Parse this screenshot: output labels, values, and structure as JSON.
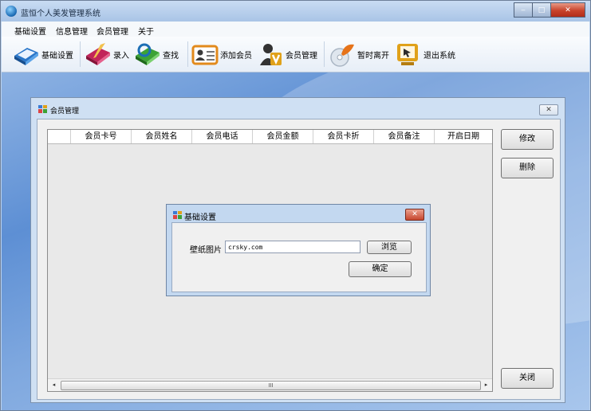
{
  "app": {
    "title": "蓝恒个人美发管理系统"
  },
  "window_controls": {
    "minimize": "‒",
    "maximize": "□",
    "close": "✕"
  },
  "menu": [
    "基础设置",
    "信息管理",
    "会员管理",
    "关于"
  ],
  "toolbar": [
    {
      "label": "基础设置",
      "icon": "settings-book-icon",
      "color": "#2a76c9"
    },
    {
      "label": "录入",
      "icon": "edit-book-icon",
      "color": "#c2245a"
    },
    {
      "label": "查找",
      "icon": "search-recycle-icon",
      "color": "#3ca235"
    },
    {
      "label": "添加会员",
      "icon": "add-member-card-icon",
      "color": "#e28a1c"
    },
    {
      "label": "会员管理",
      "icon": "member-manage-icon",
      "color": "#e0a11a"
    },
    {
      "label": "暂时离开",
      "icon": "away-disc-icon",
      "color": "#e6731a"
    },
    {
      "label": "退出系统",
      "icon": "exit-system-icon",
      "color": "#e0a11a"
    }
  ],
  "member_window": {
    "title": "会员管理",
    "close": "✕",
    "columns": [
      "会员卡号",
      "会员姓名",
      "会员电话",
      "会员金额",
      "会员卡折",
      "会员备注",
      "开启日期"
    ],
    "buttons": {
      "edit": "修改",
      "delete": "删除",
      "close": "关闭"
    },
    "scroll_thumb": "III",
    "scroll_left": "◂",
    "scroll_right": "▸"
  },
  "dialog": {
    "title": "基础设置",
    "close": "✕",
    "field_label": "壁纸图片",
    "field_value": "crsky.com",
    "browse": "浏览",
    "ok": "确定"
  }
}
